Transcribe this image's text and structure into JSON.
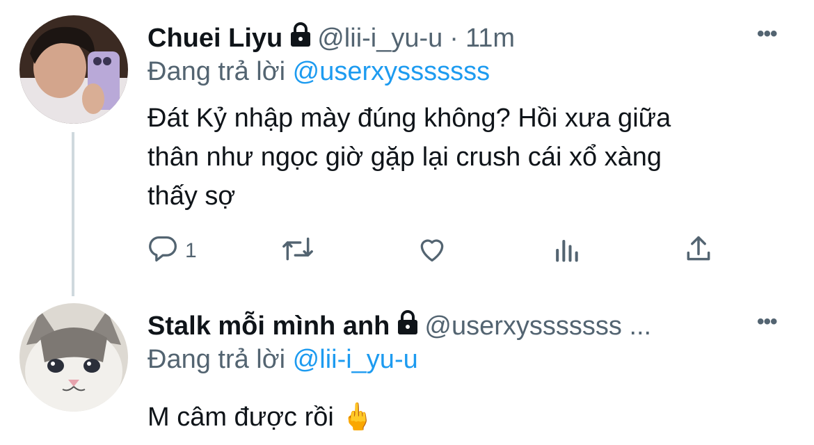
{
  "tweets": [
    {
      "name": "Chuei Liyu",
      "handle": "@lii-i_yu-u",
      "separator": "·",
      "time": "11m",
      "reply_prefix": "Đang trả lời",
      "reply_mention": "@userxysssssss",
      "text_lines": [
        "Đát Kỷ nhập mày đúng không? Hồi xưa giữa",
        "thân như ngọc giờ gặp lại crush cái xổ xàng",
        "thấy sợ"
      ],
      "avatar": "person-selfie-avatar",
      "actions": {
        "reply_icon": "reply-icon",
        "reply_count": "1",
        "retweet_icon": "retweet-icon",
        "like_icon": "heart-icon",
        "analytics_icon": "analytics-icon",
        "share_icon": "share-icon"
      }
    },
    {
      "name": "Stalk mỗi mình anh",
      "handle": "@userxysssssss ...",
      "reply_prefix": "Đang trả lời",
      "reply_mention": "@lii-i_yu-u",
      "text": "M câm được rồi",
      "emoji": "🖕",
      "avatar": "crying-cat-avatar"
    }
  ],
  "more_label": "•••",
  "colors": {
    "accent": "#1d9bf0",
    "secondary": "#536471",
    "primary": "#0f1419",
    "line": "#cfd9de"
  }
}
